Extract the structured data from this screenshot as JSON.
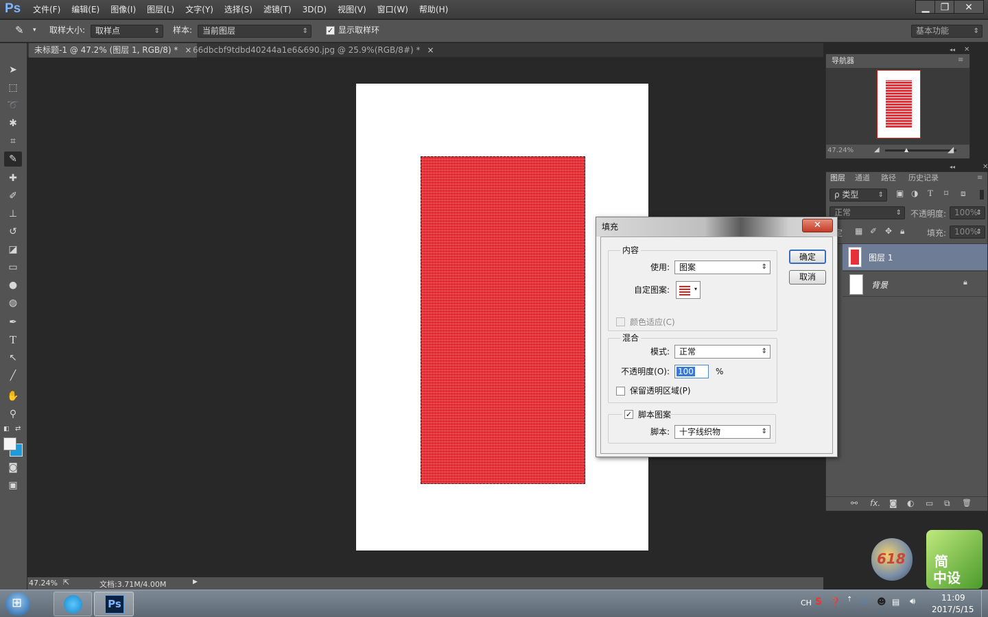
{
  "app": {
    "logo": "Ps"
  },
  "menu": [
    "文件(F)",
    "编辑(E)",
    "图像(I)",
    "图层(L)",
    "文字(Y)",
    "选择(S)",
    "滤镜(T)",
    "3D(D)",
    "视图(V)",
    "窗口(W)",
    "帮助(H)"
  ],
  "window_controls": {
    "minimize": "▁",
    "restore": "❐",
    "close": "✕"
  },
  "options": {
    "sample_size_label": "取样大小:",
    "sample_size_value": "取样点",
    "sample_label": "样本:",
    "sample_value": "当前图层",
    "show_ring_label": "显示取样环",
    "show_ring_checked": "✓",
    "workspace": "基本功能"
  },
  "tabs": [
    {
      "label": "未标题-1 @ 47.2% (图层 1, RGB/8) *",
      "close": "×"
    },
    {
      "label": "66dbcbf9tdbd40244a1e6&690.jpg @ 25.9%(RGB/8#) *",
      "close": "×"
    }
  ],
  "status": {
    "zoom": "47.24%",
    "doc": "文档:3.71M/4.00M"
  },
  "navigator": {
    "title": "导航器",
    "zoom": "47.24%"
  },
  "layers_panel": {
    "tabs": [
      "图层",
      "通道",
      "路径",
      "历史记录"
    ],
    "filter": "ρ 类型",
    "blend": "正常",
    "opacity_label": "不透明度:",
    "opacity_value": "100%",
    "lock_label": "锁定:",
    "fill_label": "填充:",
    "fill_value": "100%",
    "layers": [
      {
        "name": "图层 1"
      },
      {
        "name": "背景"
      }
    ],
    "footer_icons": [
      "⚯",
      "fx.",
      "◙",
      "◐",
      "▭",
      "⧉",
      "🗑"
    ]
  },
  "dialog": {
    "title": "填充",
    "close": "✕",
    "content_group": "内容",
    "use_label": "使用:",
    "use_value": "图案",
    "custom_pattern_label": "自定图案:",
    "color_adapt_label": "颜色适应(C)",
    "blend_group": "混合",
    "mode_label": "模式:",
    "mode_value": "正常",
    "opacity_label": "不透明度(O):",
    "opacity_value": "100",
    "percent": "%",
    "preserve_label": "保留透明区域(P)",
    "script_label": "脚本图案",
    "script_checked": "✓",
    "script_field_label": "脚本:",
    "script_value": "十字线织物",
    "ok": "确定",
    "cancel": "取消"
  },
  "desktop_widget": {
    "label1": "简",
    "label2": "中设",
    "badge": "618"
  },
  "taskbar": {
    "lang": "CH",
    "time": "11:09",
    "date": "2017/5/15",
    "ps_label": "Ps"
  }
}
